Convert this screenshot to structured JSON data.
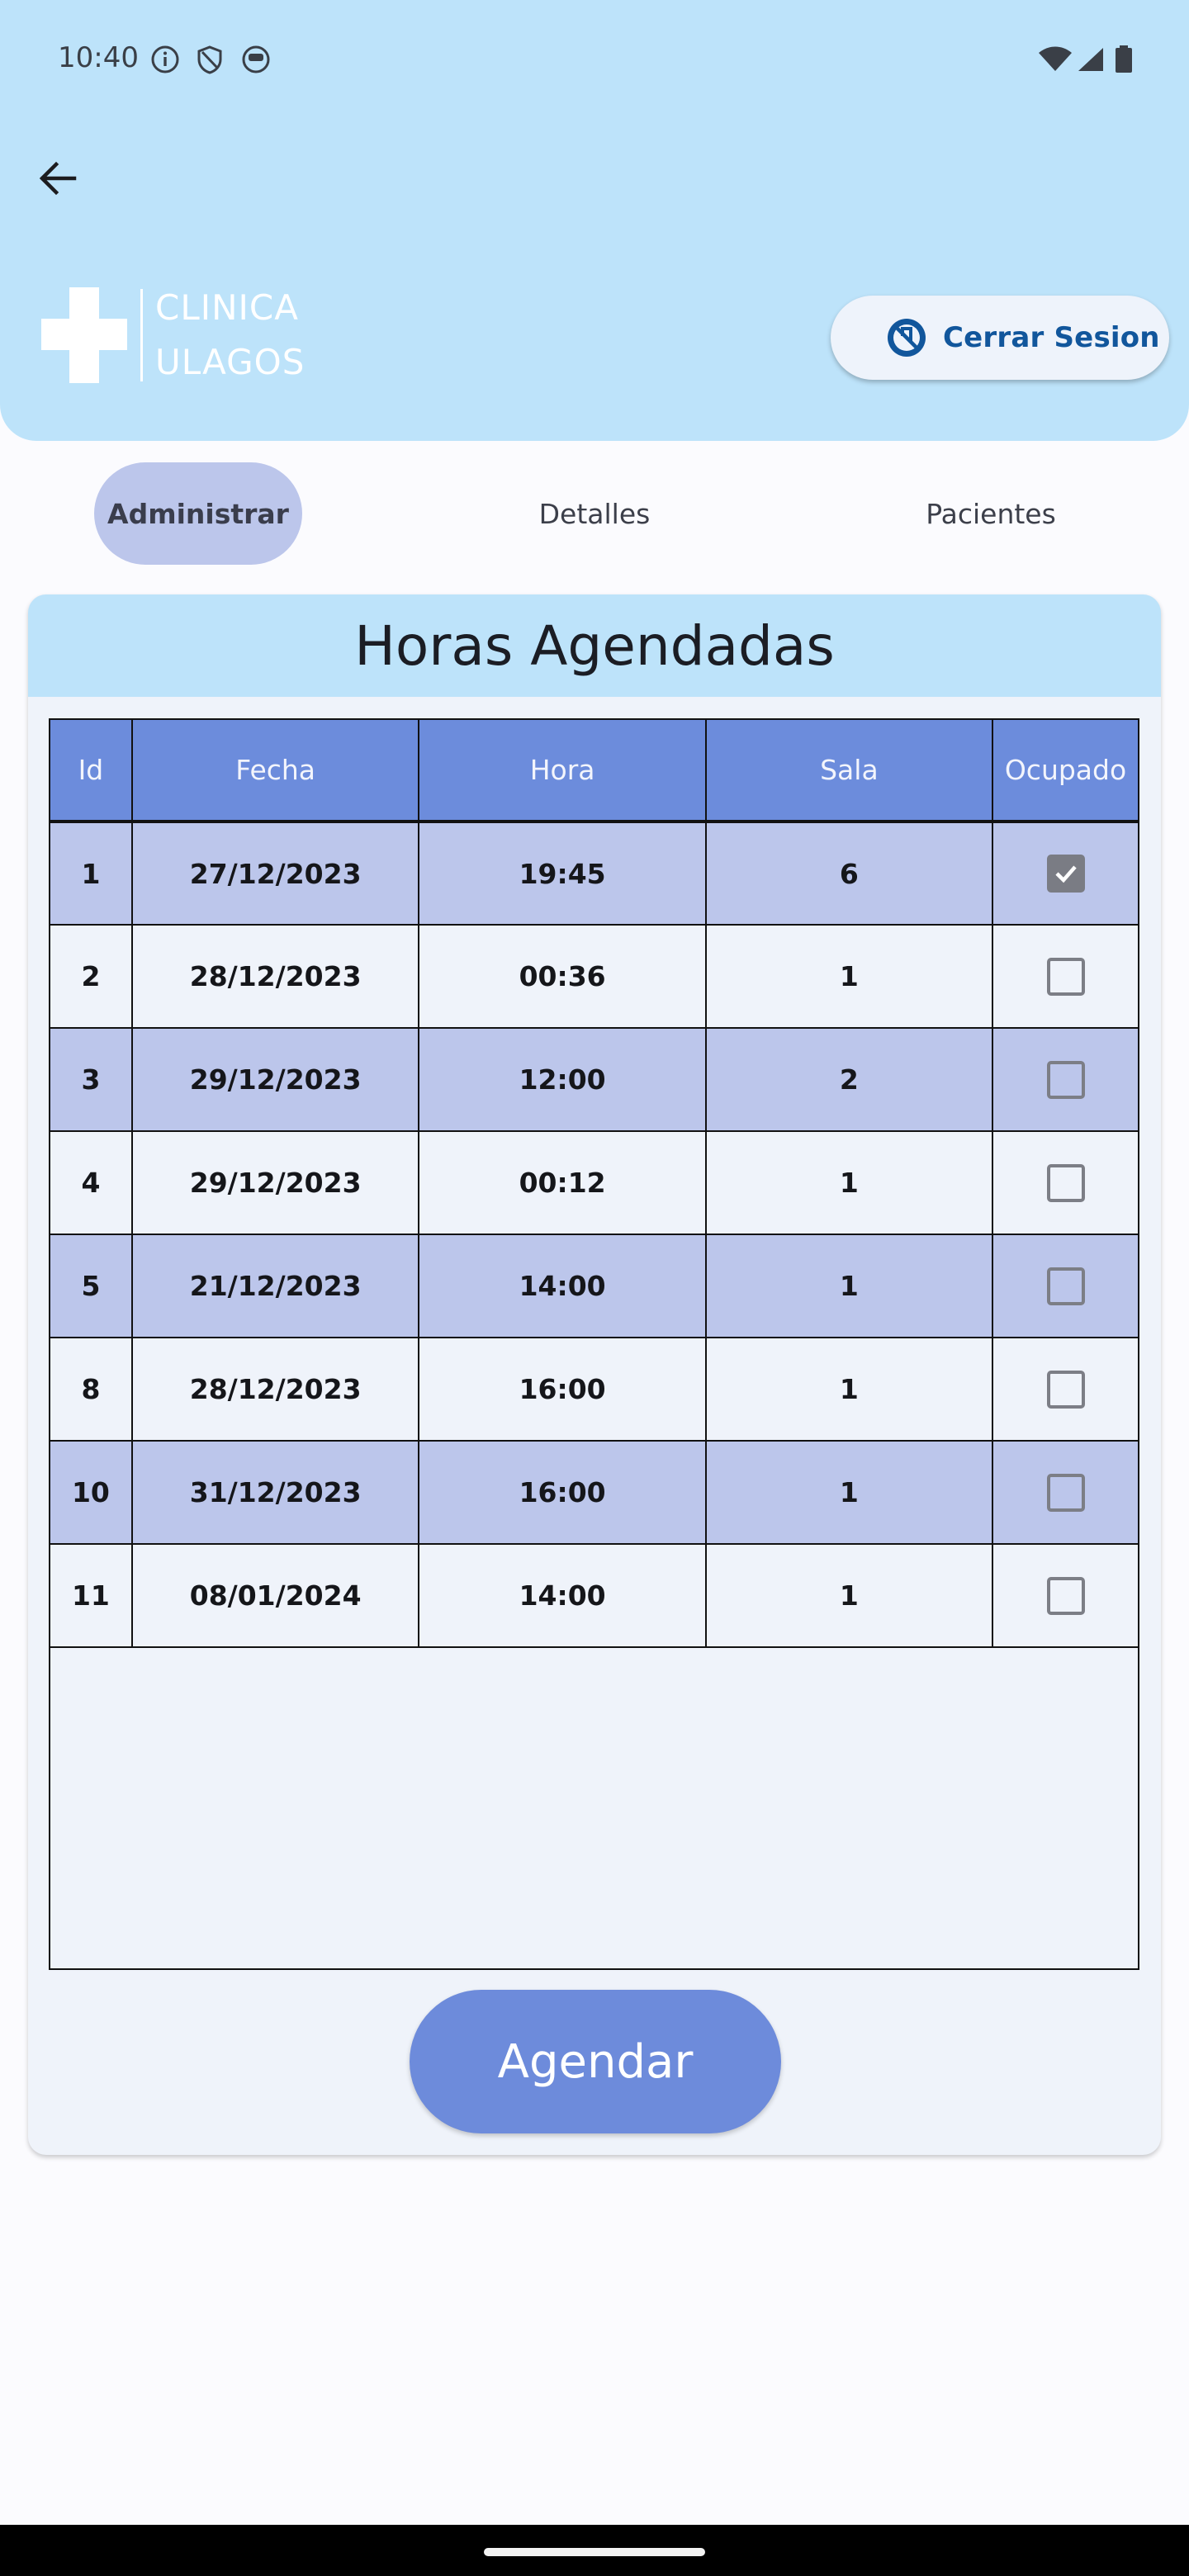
{
  "status_bar": {
    "time": "10:40",
    "left_icons": [
      "info-icon",
      "shield-icon",
      "app-icon"
    ],
    "right_icons": [
      "wifi-icon",
      "signal-icon",
      "battery-icon"
    ]
  },
  "header": {
    "back_icon": "arrow-left-icon",
    "logo": {
      "line1": "CLINICA",
      "line2": "ULAGOS"
    },
    "logout_label": "Cerrar Sesion",
    "logout_icon": "logout-icon",
    "background_color": "#bde3fa"
  },
  "tabs": [
    {
      "label": "Administrar",
      "active": true
    },
    {
      "label": "Detalles",
      "active": false
    },
    {
      "label": "Pacientes",
      "active": false
    }
  ],
  "card": {
    "title": "Horas Agendadas",
    "table": {
      "headers": [
        "Id",
        "Fecha",
        "Hora",
        "Sala",
        "Ocupado"
      ],
      "rows": [
        {
          "id": "1",
          "fecha": "27/12/2023",
          "hora": "19:45",
          "sala": "6",
          "ocupado": true
        },
        {
          "id": "2",
          "fecha": "28/12/2023",
          "hora": "00:36",
          "sala": "1",
          "ocupado": false
        },
        {
          "id": "3",
          "fecha": "29/12/2023",
          "hora": "12:00",
          "sala": "2",
          "ocupado": false
        },
        {
          "id": "4",
          "fecha": "29/12/2023",
          "hora": "00:12",
          "sala": "1",
          "ocupado": false
        },
        {
          "id": "5",
          "fecha": "21/12/2023",
          "hora": "14:00",
          "sala": "1",
          "ocupado": false
        },
        {
          "id": "8",
          "fecha": "28/12/2023",
          "hora": "16:00",
          "sala": "1",
          "ocupado": false
        },
        {
          "id": "10",
          "fecha": "31/12/2023",
          "hora": "16:00",
          "sala": "1",
          "ocupado": false
        },
        {
          "id": "11",
          "fecha": "08/01/2024",
          "hora": "14:00",
          "sala": "1",
          "ocupado": false
        }
      ]
    },
    "button_label": "Agendar"
  },
  "colors": {
    "accent": "#6d8bdb",
    "row_highlight": "#bcc6eb",
    "header_bg": "#bde3fa",
    "logout_text": "#11569c"
  }
}
